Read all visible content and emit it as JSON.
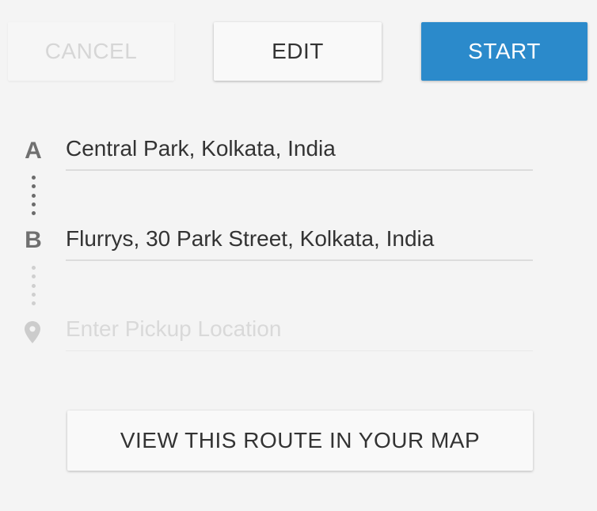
{
  "toolbar": {
    "cancel_label": "CANCEL",
    "edit_label": "EDIT",
    "start_label": "START"
  },
  "route": {
    "point_a": {
      "marker": "A",
      "value": "Central Park, Kolkata, India"
    },
    "point_b": {
      "marker": "B",
      "value": "Flurrys, 30 Park Street, Kolkata, India"
    },
    "pickup": {
      "icon": "location-pin-icon",
      "placeholder": "Enter Pickup Location",
      "value": ""
    }
  },
  "map_button_label": "VIEW THIS ROUTE IN YOUR MAP",
  "colors": {
    "accent": "#2b8acb",
    "background": "#f4f4f4",
    "disabled_text": "#d6d6d6",
    "text": "#333333"
  }
}
